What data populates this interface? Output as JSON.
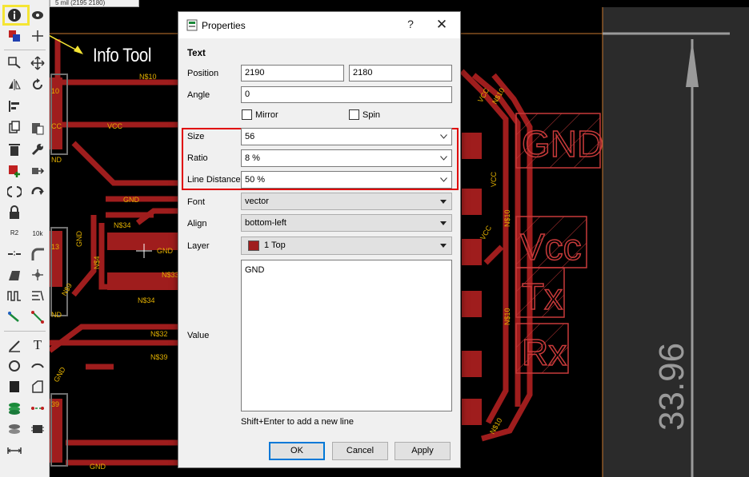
{
  "coordinate_readout": "5 mil (2195 2180)",
  "annotation": {
    "label": "Info Tool",
    "highlight_color": "#f5e534"
  },
  "board": {
    "signal_labels": [
      "N$10",
      "VCC",
      "GND",
      "N$4",
      "N$34",
      "N$33",
      "N$4",
      "N$34",
      "N$32",
      "N$39",
      "GND",
      "N$10",
      "VCC",
      "VCC",
      "VCC",
      "N$10",
      "N$10",
      "N$10",
      "GND",
      "GND",
      "N$9",
      "GND"
    ],
    "pad_labels_left": [
      "10",
      "CC",
      "ND",
      "13",
      "ND",
      "39"
    ],
    "silkscreen": [
      "GND",
      "Vcc",
      "Tx",
      "Rx"
    ],
    "dimension_value": "33.96",
    "trace_color": "#9f1d1d",
    "silk_color": "#c83a3a",
    "label_color": "#e2b000"
  },
  "dialog": {
    "title": "Properties",
    "help": "?",
    "close": "✕",
    "section": "Text",
    "position_label": "Position",
    "position_x": "2190",
    "position_y": "2180",
    "angle_label": "Angle",
    "angle_value": "0",
    "mirror_label": "Mirror",
    "spin_label": "Spin",
    "size_label": "Size",
    "size_value": "56",
    "ratio_label": "Ratio",
    "ratio_value": "8 %",
    "line_distance_label": "Line Distance",
    "line_distance_value": "50 %",
    "font_label": "Font",
    "font_value": "vector",
    "align_label": "Align",
    "align_value": "bottom-left",
    "layer_label": "Layer",
    "layer_value": "1 Top",
    "layer_color": "#9f1d1d",
    "value_label": "Value",
    "value_text": "GND",
    "hint": "Shift+Enter to add a new line",
    "ok": "OK",
    "cancel": "Cancel",
    "apply": "Apply",
    "highlight_color": "#e00000"
  },
  "toolbar": {
    "icons": [
      "info-icon",
      "eye-icon",
      "layers-icon",
      "origin-icon",
      "move-icon",
      "mirror-icon",
      "rotate-icon",
      "align-icon",
      "copy-icon",
      "paste-icon",
      "delete-icon",
      "wrench-icon",
      "add-icon",
      "replace-icon",
      "smash-icon",
      "change-icon",
      "lock-icon",
      "name-icon",
      "value-icon",
      "split-icon",
      "miter-icon",
      "optimize-icon",
      "route-icon",
      "meander-icon",
      "ripup-icon",
      "wire-icon",
      "text-icon",
      "circle-icon",
      "arc-icon",
      "rect-icon",
      "polygon-icon",
      "via-icon",
      "signal-icon",
      "hole-icon",
      "attribute-icon",
      "dimension-icon"
    ],
    "text_tool_glyph": "T",
    "r2_label": "R2",
    "r2_sub": "10k"
  }
}
